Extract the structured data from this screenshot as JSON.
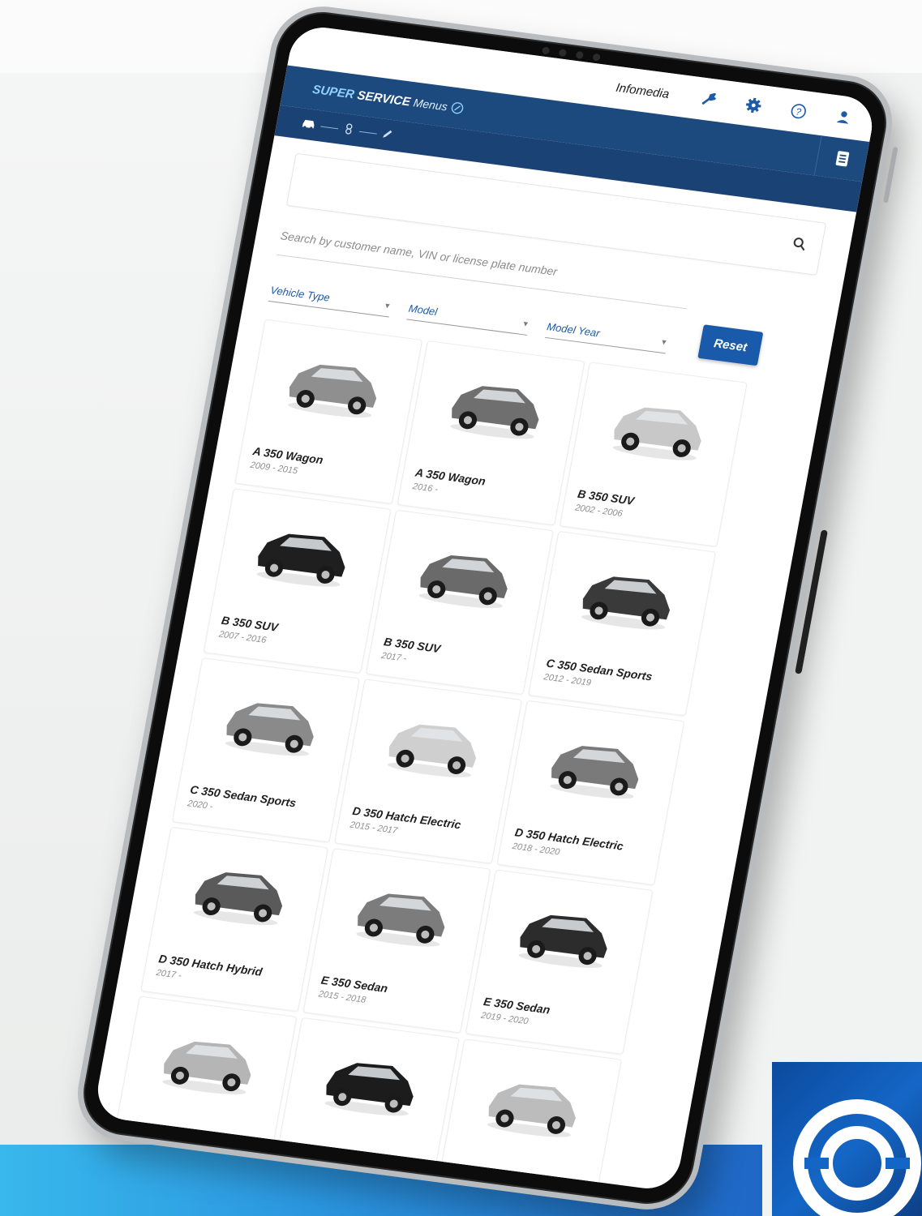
{
  "topbar": {
    "org_name": "Infomedia",
    "icons": [
      "wrench-icon",
      "gear-icon",
      "help-icon",
      "user-icon"
    ]
  },
  "appbar": {
    "brand_super": "SUPER",
    "brand_service": "SERVICE",
    "brand_menus": "Menus",
    "menu_icon": "list-icon"
  },
  "stepper": {
    "steps": [
      "car-icon",
      "link-icon",
      "pencil-icon"
    ]
  },
  "search": {
    "placeholder": "Search by customer name, VIN or license plate number",
    "icon": "search-icon"
  },
  "filters": {
    "vehicle_type": "Vehicle Type",
    "model": "Model",
    "model_year": "Model Year",
    "reset_label": "Reset"
  },
  "vehicles": [
    {
      "name": "A 350 Wagon",
      "years": "2009 - 2015",
      "color": "#8f8f8f"
    },
    {
      "name": "A 350 Wagon",
      "years": "2016 -",
      "color": "#6f6f6f"
    },
    {
      "name": "B 350 SUV",
      "years": "2002 - 2006",
      "color": "#c8c8c8"
    },
    {
      "name": "B 350 SUV",
      "years": "2007 - 2016",
      "color": "#1f1f1f"
    },
    {
      "name": "B 350 SUV",
      "years": "2017 -",
      "color": "#6a6a6a"
    },
    {
      "name": "C 350 Sedan Sports",
      "years": "2012 - 2019",
      "color": "#3a3a3a"
    },
    {
      "name": "C 350 Sedan Sports",
      "years": "2020 -",
      "color": "#8a8a8a"
    },
    {
      "name": "D 350 Hatch Electric",
      "years": "2015 - 2017",
      "color": "#cfcfcf"
    },
    {
      "name": "D 350 Hatch Electric",
      "years": "2018 - 2020",
      "color": "#7a7a7a"
    },
    {
      "name": "D 350 Hatch Hybrid",
      "years": "2017 -",
      "color": "#5a5a5a"
    },
    {
      "name": "E 350 Sedan",
      "years": "2015 - 2018",
      "color": "#7c7c7c"
    },
    {
      "name": "E 350 Sedan",
      "years": "2019 - 2020",
      "color": "#2c2c2c"
    },
    {
      "name": "",
      "years": "",
      "color": "#b5b5b5"
    },
    {
      "name": "",
      "years": "",
      "color": "#1c1c1c"
    },
    {
      "name": "",
      "years": "",
      "color": "#bcbcbc"
    }
  ],
  "colors": {
    "appbar": "#1d4a7e",
    "accent": "#1a5aaa",
    "bottom_band": "#2a93de",
    "brand_tile": "#1466c6"
  }
}
